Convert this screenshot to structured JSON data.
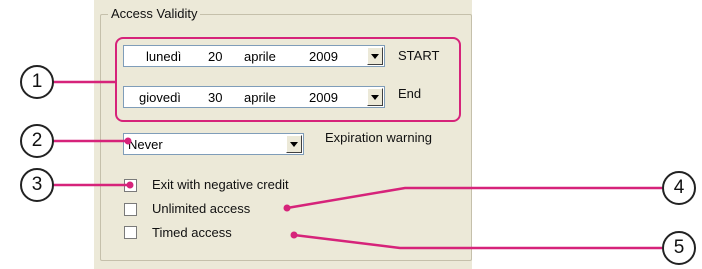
{
  "group": {
    "title": "Access Validity"
  },
  "start_date": {
    "day_name": "lunedì",
    "day": "20",
    "month": "aprile",
    "year": "2009",
    "label": "START"
  },
  "end_date": {
    "day_name": "giovedì",
    "day": "30",
    "month": "aprile",
    "year": "2009",
    "label": "End"
  },
  "expiration": {
    "selected": "Never",
    "label": "Expiration warning"
  },
  "options": [
    {
      "label": "Exit with negative credit",
      "checked": false
    },
    {
      "label": "Unlimited access",
      "checked": false
    },
    {
      "label": "Timed access",
      "checked": false
    }
  ],
  "callouts": [
    "1",
    "2",
    "3",
    "4",
    "5"
  ],
  "colors": {
    "annotation": "#d6237a",
    "panel": "#ece9d8",
    "border": "#7f9db9"
  }
}
